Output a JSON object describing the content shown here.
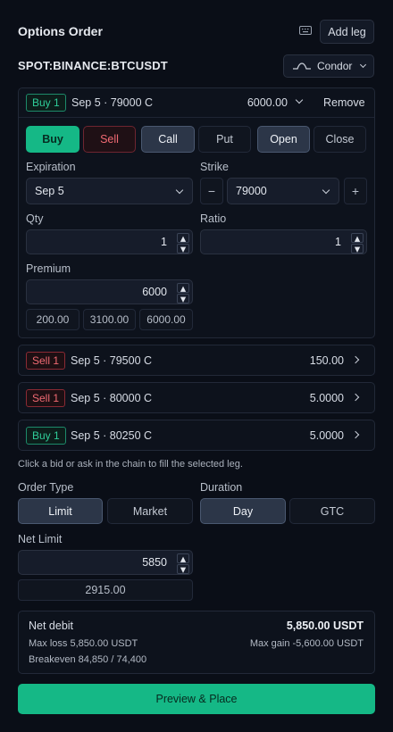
{
  "header": {
    "title": "Options Order",
    "add_leg_label": "Add leg"
  },
  "symbol": "SPOT:BINANCE:BTCUSDT",
  "strategy": {
    "label": "Condor"
  },
  "active_leg": {
    "side_badge": "Buy 1",
    "summary": "Sep 5 · 79000 C",
    "premium": "6000.00",
    "remove_label": "Remove",
    "side_buttons": [
      "Buy",
      "Sell"
    ],
    "type_buttons": [
      "Call",
      "Put"
    ],
    "action_buttons": [
      "Open",
      "Close"
    ],
    "expiration_label": "Expiration",
    "expiration_value": "Sep 5",
    "strike_label": "Strike",
    "strike_value": "79000",
    "strike_minus": "−",
    "strike_plus": "+",
    "qty_label": "Qty",
    "qty_value": "1",
    "ratio_label": "Ratio",
    "ratio_value": "1",
    "premium_label": "Premium",
    "premium_value": "6000",
    "premium_presets": [
      "200.00",
      "3100.00",
      "6000.00"
    ]
  },
  "legs": [
    {
      "side": "Sell 1",
      "summary": "Sep 5 · 79500 C",
      "value": "150.00"
    },
    {
      "side": "Sell 1",
      "summary": "Sep 5 · 80000 C",
      "value": "5.0000"
    },
    {
      "side": "Buy 1",
      "summary": "Sep 5 · 80250 C",
      "value": "5.0000"
    }
  ],
  "hint": "Click a bid or ask in the chain to fill the selected leg.",
  "order_type": {
    "label": "Order Type",
    "options": [
      "Limit",
      "Market"
    ],
    "selected": "Limit"
  },
  "duration": {
    "label": "Duration",
    "options": [
      "Day",
      "GTC"
    ],
    "selected": "Day"
  },
  "net_limit": {
    "label": "Net Limit",
    "value": "5850",
    "preset": "2915.00"
  },
  "summary": {
    "net_label": "Net debit",
    "net_value": "5,850.00 USDT",
    "max_loss": "Max loss 5,850.00 USDT",
    "max_gain": "Max gain -5,600.00 USDT",
    "breakeven": "Breakeven 84,850 / 74,400"
  },
  "submit_label": "Preview & Place",
  "colors": {
    "accent": "#15b886",
    "buy": "#2fcc98",
    "sell": "#f06a73",
    "background": "#0a0e17"
  }
}
